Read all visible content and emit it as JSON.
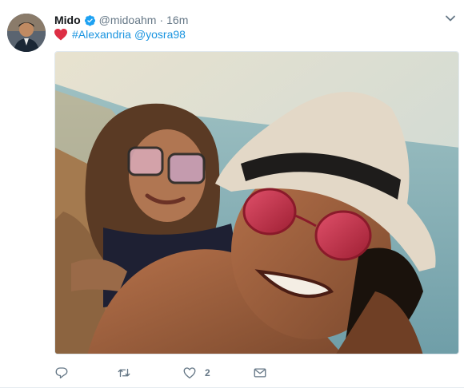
{
  "tweet": {
    "author": {
      "name": "Mido",
      "handle": "@midoahm",
      "verified": true,
      "avatar_icon": "avatar-photo"
    },
    "separator": "·",
    "time": "16m",
    "text": {
      "emoji": "red-heart",
      "hashtag": "#Alexandria",
      "mention": "@yosra98"
    },
    "media": {
      "type": "photo",
      "description_icon": "beach-selfie-photo"
    },
    "actions": {
      "reply_icon": "reply-icon",
      "retweet_icon": "retweet-icon",
      "like_icon": "heart-icon",
      "like_count": "2",
      "message_icon": "envelope-icon"
    },
    "colors": {
      "link": "#1b95e0",
      "verified": "#1da1f2",
      "heart": "#e0245e",
      "muted": "#657786"
    }
  }
}
